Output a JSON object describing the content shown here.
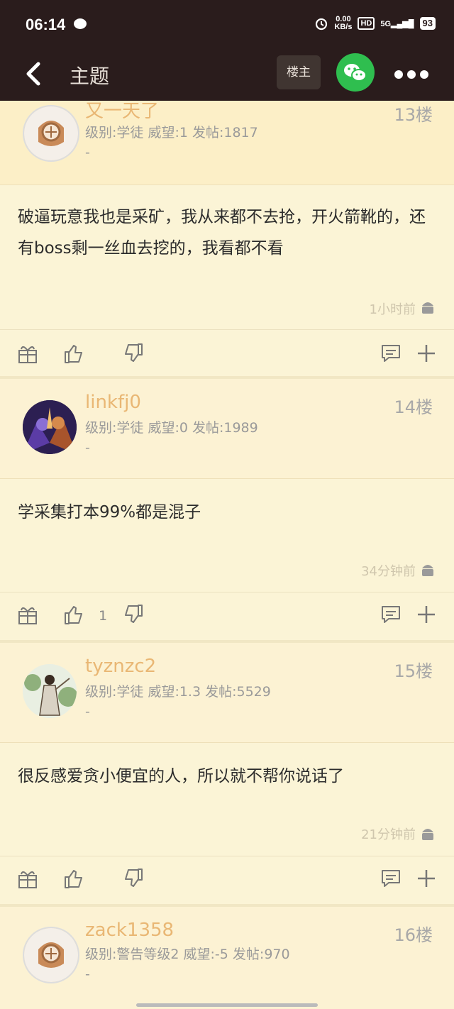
{
  "status": {
    "time": "06:14",
    "speed_value": "0.00",
    "speed_unit": "KB/s",
    "hd": "HD",
    "signal": "5G",
    "battery": "93"
  },
  "nav": {
    "title": "主题",
    "owner_button": "楼主"
  },
  "posts": [
    {
      "username": "又一天了",
      "meta": "级别:学徒  威望:1  发帖:1817",
      "dash": "-",
      "floor": "13楼",
      "content": "破逼玩意我也是采矿，我从来都不去抢，开火箭靴的，还有boss剩一丝血去挖的，我看都不看",
      "time": "1小时前",
      "likes": ""
    },
    {
      "username": "linkfj0",
      "meta": "级别:学徒  威望:0  发帖:1989",
      "dash": "-",
      "floor": "14楼",
      "content": "学采集打本99%都是混子",
      "time": "34分钟前",
      "likes": "1"
    },
    {
      "username": "tyznzc2",
      "meta": "级别:学徒  威望:1.3  发帖:5529",
      "dash": "-",
      "floor": "15楼",
      "content": "很反感爱贪小便宜的人，所以就不帮你说话了",
      "time": "21分钟前",
      "likes": ""
    },
    {
      "username": "zack1358",
      "meta": "级别:警告等级2  威望:-5  发帖:970",
      "dash": "-",
      "floor": "16楼"
    }
  ]
}
